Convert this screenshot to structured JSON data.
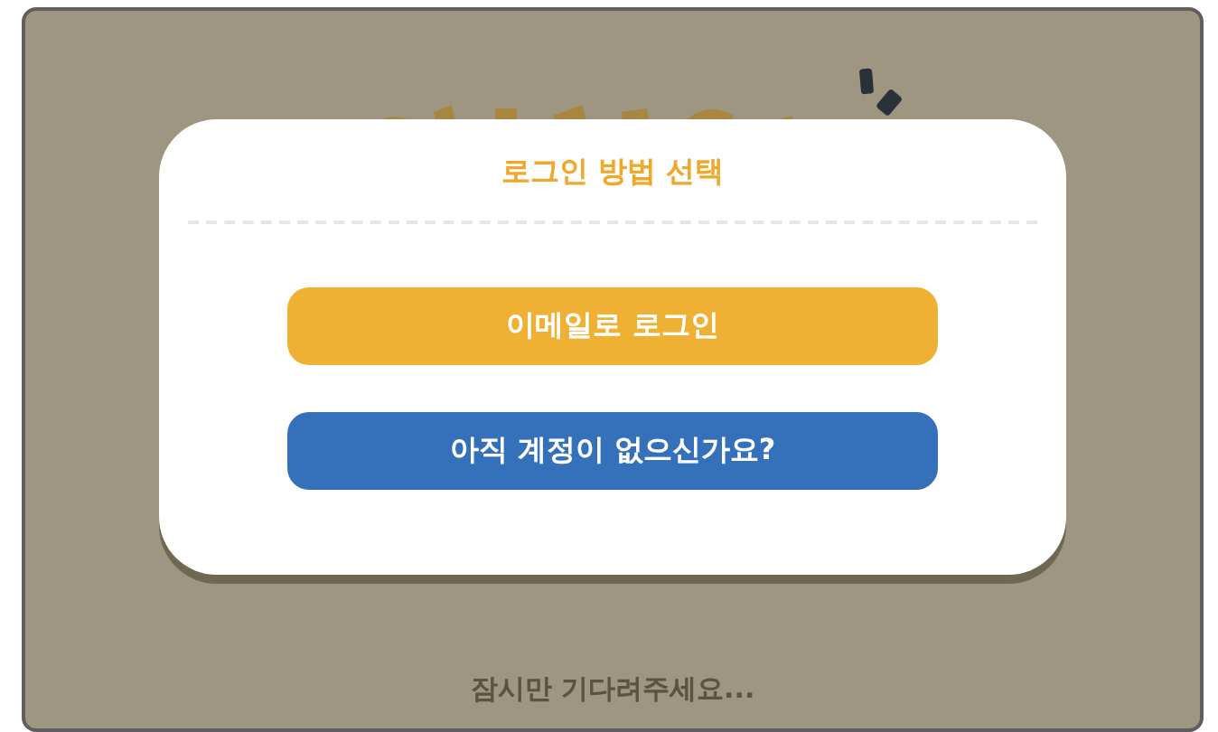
{
  "dialog": {
    "title": "로그인 방법 선택",
    "buttons": [
      {
        "label": "이메일로 로그인",
        "kind": "primary"
      },
      {
        "label": "아직 계정이 없으신가요?",
        "kind": "secondary"
      }
    ]
  },
  "status_text": "잠시만 기다려주세요..."
}
